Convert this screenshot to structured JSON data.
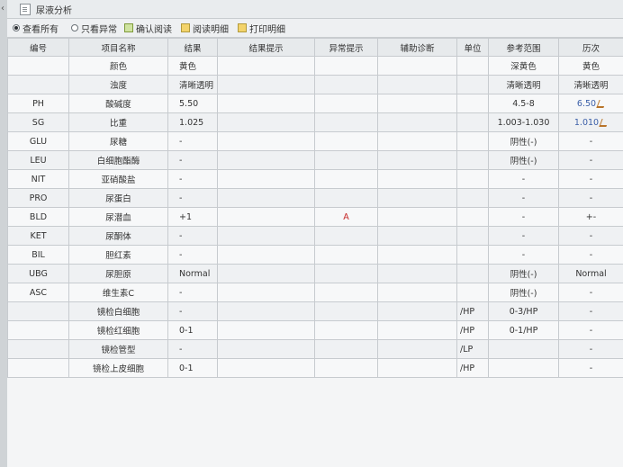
{
  "window": {
    "title": "尿液分析"
  },
  "toolbar": {
    "filters": [
      {
        "label": "查看所有",
        "selected": true
      },
      {
        "label": "只看异常",
        "selected": false
      }
    ],
    "buttons": [
      {
        "label": "确认阅读",
        "icon": "check-doc-icon"
      },
      {
        "label": "阅读明细",
        "icon": "folder-icon"
      },
      {
        "label": "打印明细",
        "icon": "print-icon"
      }
    ]
  },
  "table": {
    "headers": [
      "编号",
      "项目名称",
      "结果",
      "结果提示",
      "异常提示",
      "辅助诊断",
      "单位",
      "参考范围",
      "历次"
    ],
    "rows": [
      {
        "code": "",
        "name": "颜色",
        "result": "黄色",
        "hint": "",
        "abnormal": "",
        "aux": "",
        "unit": "",
        "range": "深黄色",
        "history": "黄色",
        "history_blue": false,
        "edit": false
      },
      {
        "code": "",
        "name": "浊度",
        "result": "清晰透明",
        "hint": "",
        "abnormal": "",
        "aux": "",
        "unit": "",
        "range": "清晰透明",
        "history": "清晰透明",
        "history_blue": false,
        "edit": false
      },
      {
        "code": "PH",
        "name": "酸碱度",
        "result": "5.50",
        "hint": "",
        "abnormal": "",
        "aux": "",
        "unit": "",
        "range": "4.5-8",
        "history": "6.50",
        "history_blue": true,
        "edit": true
      },
      {
        "code": "SG",
        "name": "比重",
        "result": "1.025",
        "hint": "",
        "abnormal": "",
        "aux": "",
        "unit": "",
        "range": "1.003-1.030",
        "history": "1.010",
        "history_blue": true,
        "edit": true
      },
      {
        "code": "GLU",
        "name": "尿糖",
        "result": "-",
        "hint": "",
        "abnormal": "",
        "aux": "",
        "unit": "",
        "range": "阴性(-)",
        "history": "-",
        "history_blue": false,
        "edit": false
      },
      {
        "code": "LEU",
        "name": "白细胞酯酶",
        "result": "-",
        "hint": "",
        "abnormal": "",
        "aux": "",
        "unit": "",
        "range": "阴性(-)",
        "history": "-",
        "history_blue": false,
        "edit": false
      },
      {
        "code": "NIT",
        "name": "亚硝酸盐",
        "result": "-",
        "hint": "",
        "abnormal": "",
        "aux": "",
        "unit": "",
        "range": "-",
        "history": "-",
        "history_blue": false,
        "edit": false
      },
      {
        "code": "PRO",
        "name": "尿蛋白",
        "result": "-",
        "hint": "",
        "abnormal": "",
        "aux": "",
        "unit": "",
        "range": "-",
        "history": "-",
        "history_blue": false,
        "edit": false
      },
      {
        "code": "BLD",
        "name": "尿潜血",
        "result": "+1",
        "hint": "",
        "abnormal": "A",
        "aux": "",
        "unit": "",
        "range": "-",
        "history": "+-",
        "history_blue": false,
        "edit": false
      },
      {
        "code": "KET",
        "name": "尿酮体",
        "result": "-",
        "hint": "",
        "abnormal": "",
        "aux": "",
        "unit": "",
        "range": "-",
        "history": "-",
        "history_blue": false,
        "edit": false
      },
      {
        "code": "BIL",
        "name": "胆红素",
        "result": "-",
        "hint": "",
        "abnormal": "",
        "aux": "",
        "unit": "",
        "range": "-",
        "history": "-",
        "history_blue": false,
        "edit": false
      },
      {
        "code": "UBG",
        "name": "尿胆原",
        "result": "Normal",
        "hint": "",
        "abnormal": "",
        "aux": "",
        "unit": "",
        "range": "阴性(-)",
        "history": "Normal",
        "history_blue": false,
        "edit": false
      },
      {
        "code": "ASC",
        "name": "维生素C",
        "result": "-",
        "hint": "",
        "abnormal": "",
        "aux": "",
        "unit": "",
        "range": "阴性(-)",
        "history": "-",
        "history_blue": false,
        "edit": false
      },
      {
        "code": "",
        "name": "镜检白细胞",
        "result": "-",
        "hint": "",
        "abnormal": "",
        "aux": "",
        "unit": "/HP",
        "range": "0-3/HP",
        "history": "-",
        "history_blue": false,
        "edit": false
      },
      {
        "code": "",
        "name": "镜检红细胞",
        "result": "0-1",
        "hint": "",
        "abnormal": "",
        "aux": "",
        "unit": "/HP",
        "range": "0-1/HP",
        "history": "-",
        "history_blue": false,
        "edit": false
      },
      {
        "code": "",
        "name": "镜检管型",
        "result": "-",
        "hint": "",
        "abnormal": "",
        "aux": "",
        "unit": "/LP",
        "range": "",
        "history": "-",
        "history_blue": false,
        "edit": false
      },
      {
        "code": "",
        "name": "镜检上皮细胞",
        "result": "0-1",
        "hint": "",
        "abnormal": "",
        "aux": "",
        "unit": "/HP",
        "range": "",
        "history": "-",
        "history_blue": false,
        "edit": false
      }
    ]
  }
}
